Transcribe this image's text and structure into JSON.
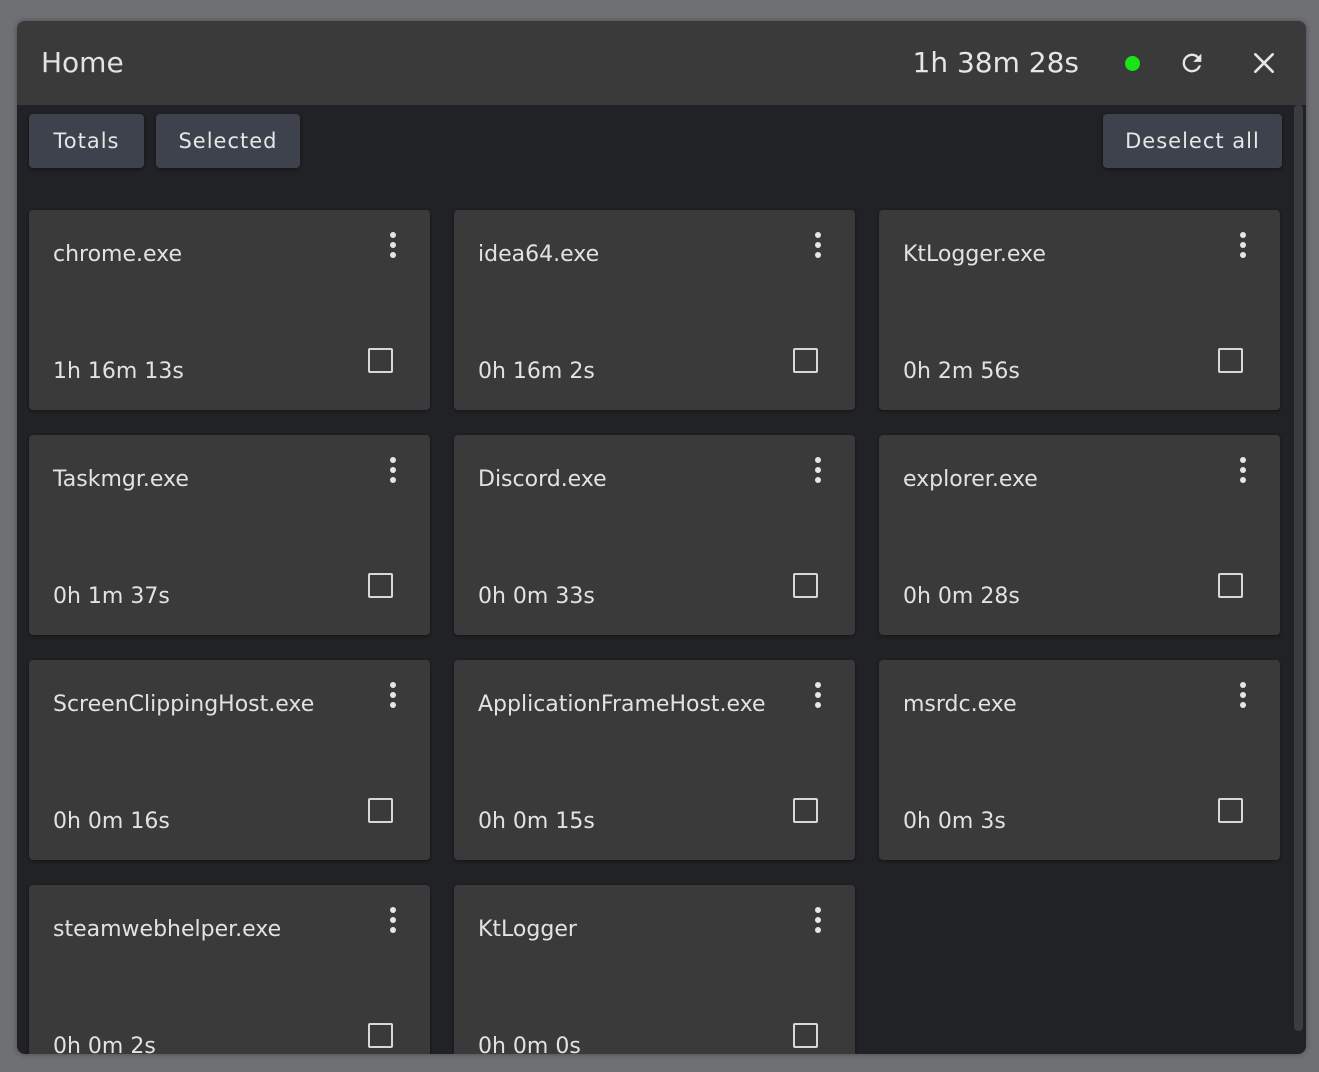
{
  "window": {
    "title": "Home",
    "total_time": "1h 38m 28s",
    "status_color": "#18e418",
    "icons": [
      "refresh-icon",
      "close-icon"
    ]
  },
  "toolbar": {
    "totals_label": "Totals",
    "selected_label": "Selected",
    "deselect_all_label": "Deselect all"
  },
  "processes": [
    {
      "name": "chrome.exe",
      "time": "1h 16m 13s",
      "selected": false
    },
    {
      "name": "idea64.exe",
      "time": "0h 16m 2s",
      "selected": false
    },
    {
      "name": "KtLogger.exe",
      "time": "0h 2m 56s",
      "selected": false
    },
    {
      "name": "Taskmgr.exe",
      "time": "0h 1m 37s",
      "selected": false
    },
    {
      "name": "Discord.exe",
      "time": "0h 0m 33s",
      "selected": false
    },
    {
      "name": "explorer.exe",
      "time": "0h 0m 28s",
      "selected": false
    },
    {
      "name": "ScreenClippingHost.exe",
      "time": "0h 0m 16s",
      "selected": false
    },
    {
      "name": "ApplicationFrameHost.exe",
      "time": "0h 0m 15s",
      "selected": false
    },
    {
      "name": "msrdc.exe",
      "time": "0h 0m 3s",
      "selected": false
    },
    {
      "name": "steamwebhelper.exe",
      "time": "0h 0m 2s",
      "selected": false
    },
    {
      "name": "KtLogger",
      "time": "0h 0m 0s",
      "selected": false
    }
  ]
}
